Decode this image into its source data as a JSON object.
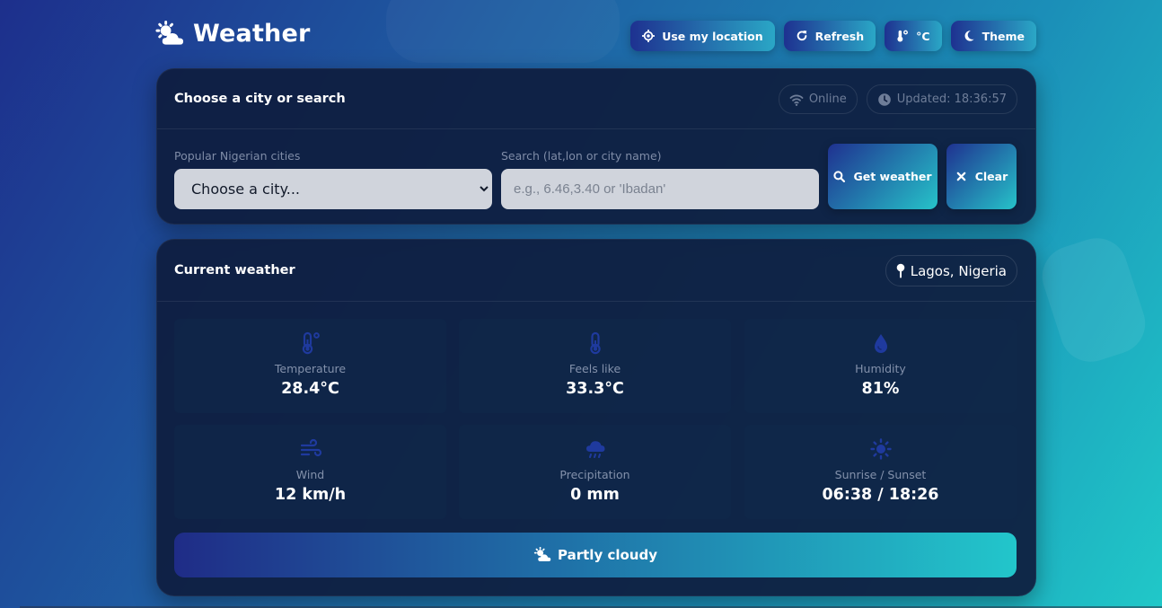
{
  "header": {
    "title": "Weather",
    "buttons": {
      "location": "Use my location",
      "refresh": "Refresh",
      "units": "°C",
      "theme": "Theme"
    }
  },
  "search_card": {
    "title": "Choose a city or search",
    "status": "Online",
    "updated": "Updated: 18:36:57",
    "city_label": "Popular Nigerian cities",
    "city_selected": "Choose a city...",
    "search_label": "Search (lat,lon or city name)",
    "search_placeholder": "e.g., 6.46,3.40 or 'Ibadan'",
    "search_value": "",
    "get_label": "Get weather",
    "clear_label": "Clear"
  },
  "weather_card": {
    "title": "Current weather",
    "location": "Lagos, Nigeria",
    "metrics": [
      {
        "label": "Temperature",
        "value": "28.4°C",
        "icon": "thermometer-half-icon"
      },
      {
        "label": "Feels like",
        "value": "33.3°C",
        "icon": "thermometer-icon"
      },
      {
        "label": "Humidity",
        "value": "81%",
        "icon": "droplet-icon"
      },
      {
        "label": "Wind",
        "value": "12 km/h",
        "icon": "wind-icon"
      },
      {
        "label": "Precipitation",
        "value": "0 mm",
        "icon": "cloud-rain-icon"
      },
      {
        "label": "Sunrise / Sunset",
        "value": "06:38 / 18:26",
        "icon": "sun-icon"
      }
    ],
    "condition": "Partly cloudy"
  },
  "colors": {
    "accent_start": "#1f3190",
    "accent_end": "#26c3c9",
    "card_bg": "#0e1d3e",
    "metric_icon": "#1f3a9e"
  }
}
